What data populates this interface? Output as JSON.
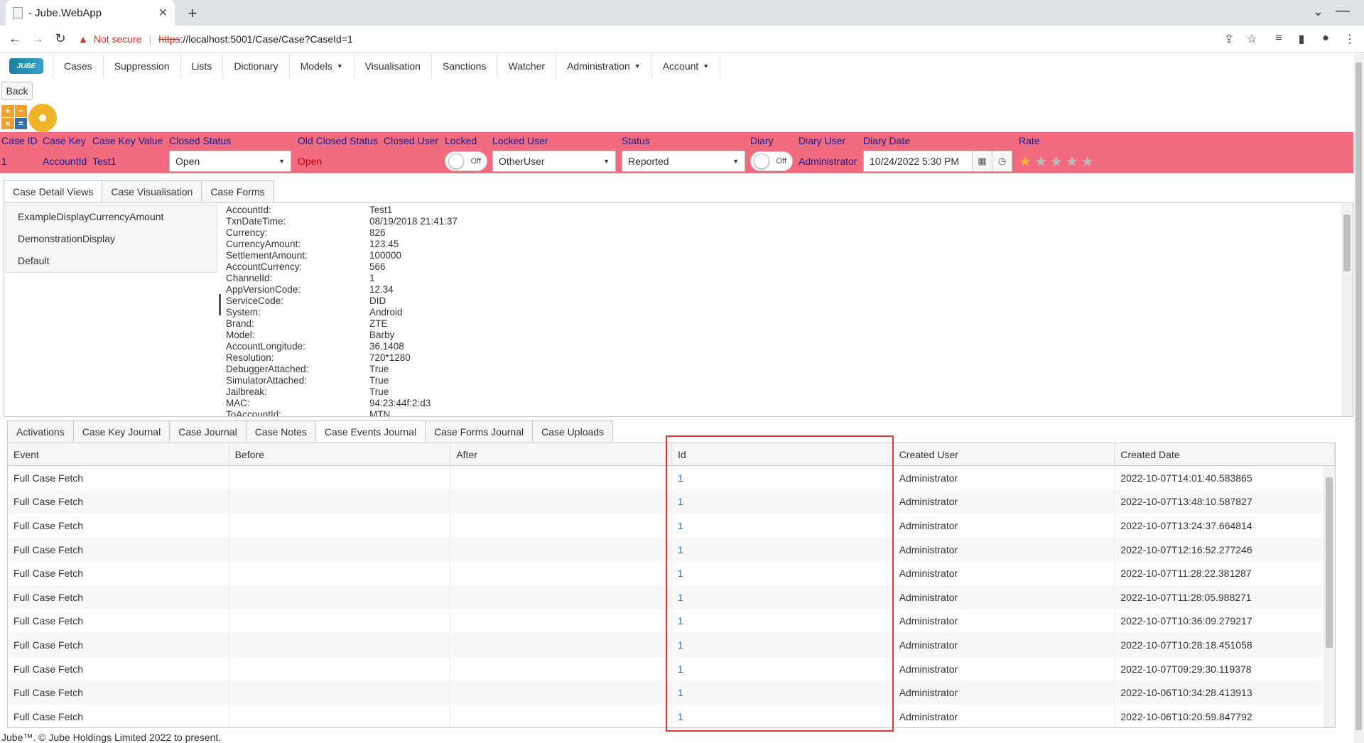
{
  "browser": {
    "tab_title": "- Jube.WebApp",
    "not_secure": "Not secure",
    "url_scheme": "https",
    "url_rest": "://localhost:5001/Case/Case?CaseId=1"
  },
  "nav": {
    "logo_text": "JUBE",
    "items": [
      "Cases",
      "Suppression",
      "Lists",
      "Dictionary",
      "Models",
      "Visualisation",
      "Sanctions",
      "Watcher",
      "Administration",
      "Account"
    ]
  },
  "back_label": "Back",
  "calc_keys": [
    "+",
    "−",
    "×",
    "="
  ],
  "case_header": {
    "labels": {
      "case_id": "Case ID",
      "case_key": "Case Key",
      "case_key_value": "Case Key Value",
      "closed_status": "Closed Status",
      "old_closed_status": "Old Closed Status",
      "closed_user": "Closed User",
      "locked": "Locked",
      "locked_user": "Locked User",
      "status": "Status",
      "diary": "Diary",
      "diary_user": "Diary User",
      "diary_date": "Diary Date",
      "rate": "Rate"
    },
    "values": {
      "case_id": "1",
      "case_key": "AccountId",
      "case_key_value": "Test1",
      "closed_status": "Open",
      "old_closed_status": "Open",
      "locked": "Off",
      "locked_user": "OtherUser",
      "status": "Reported",
      "diary": "Off",
      "diary_user": "Administrator",
      "diary_date": "10/24/2022 5:30 PM",
      "rating": 1
    }
  },
  "colors": {
    "header_bg": "#f36b7f",
    "link": "#2a6ebb",
    "highlight": "#e53935",
    "star": "#f0b429"
  },
  "detail_tabs": [
    "Case Detail Views",
    "Case Visualisation",
    "Case Forms"
  ],
  "views": [
    "ExampleDisplayCurrencyAmount",
    "DemonstrationDisplay",
    "Default"
  ],
  "payload": [
    [
      "AccountId:",
      "Test1"
    ],
    [
      "TxnDateTime:",
      "08/19/2018 21:41:37"
    ],
    [
      "Currency:",
      "826"
    ],
    [
      "CurrencyAmount:",
      "123.45"
    ],
    [
      "SettlementAmount:",
      "100000"
    ],
    [
      "AccountCurrency:",
      "566"
    ],
    [
      "ChannelId:",
      "1"
    ],
    [
      "AppVersionCode:",
      "12.34"
    ],
    [
      "ServiceCode:",
      "DID"
    ],
    [
      "System:",
      "Android"
    ],
    [
      "Brand:",
      "ZTE"
    ],
    [
      "Model:",
      "Barby"
    ],
    [
      "AccountLongitude:",
      "36.1408"
    ],
    [
      "Resolution:",
      "720*1280"
    ],
    [
      "DebuggerAttached:",
      "True"
    ],
    [
      "SimulatorAttached:",
      "True"
    ],
    [
      "Jailbreak:",
      "True"
    ],
    [
      "MAC:",
      "94:23:44f:2:d3"
    ],
    [
      "ToAccountId:",
      "MTN"
    ]
  ],
  "journal_tabs": [
    "Activations",
    "Case Key Journal",
    "Case Journal",
    "Case Notes",
    "Case Events Journal",
    "Case Forms Journal",
    "Case Uploads"
  ],
  "events": {
    "columns": [
      "Event",
      "Before",
      "After",
      "Id",
      "Created User",
      "Created Date"
    ],
    "rows": [
      [
        "Full Case Fetch",
        "",
        "",
        "1",
        "Administrator",
        "2022-10-07T14:01:40.583865"
      ],
      [
        "Full Case Fetch",
        "",
        "",
        "1",
        "Administrator",
        "2022-10-07T13:48:10.587827"
      ],
      [
        "Full Case Fetch",
        "",
        "",
        "1",
        "Administrator",
        "2022-10-07T13:24:37.664814"
      ],
      [
        "Full Case Fetch",
        "",
        "",
        "1",
        "Administrator",
        "2022-10-07T12:16:52.277246"
      ],
      [
        "Full Case Fetch",
        "",
        "",
        "1",
        "Administrator",
        "2022-10-07T11:28:22.381287"
      ],
      [
        "Full Case Fetch",
        "",
        "",
        "1",
        "Administrator",
        "2022-10-07T11:28:05.988271"
      ],
      [
        "Full Case Fetch",
        "",
        "",
        "1",
        "Administrator",
        "2022-10-07T10:36:09.279217"
      ],
      [
        "Full Case Fetch",
        "",
        "",
        "1",
        "Administrator",
        "2022-10-07T10:28:18.451058"
      ],
      [
        "Full Case Fetch",
        "",
        "",
        "1",
        "Administrator",
        "2022-10-07T09:29:30.119378"
      ],
      [
        "Full Case Fetch",
        "",
        "",
        "1",
        "Administrator",
        "2022-10-06T10:34:28.413913"
      ],
      [
        "Full Case Fetch",
        "",
        "",
        "1",
        "Administrator",
        "2022-10-06T10:20:59.847792"
      ]
    ]
  },
  "footer": "Jube™. © Jube Holdings Limited 2022 to present."
}
